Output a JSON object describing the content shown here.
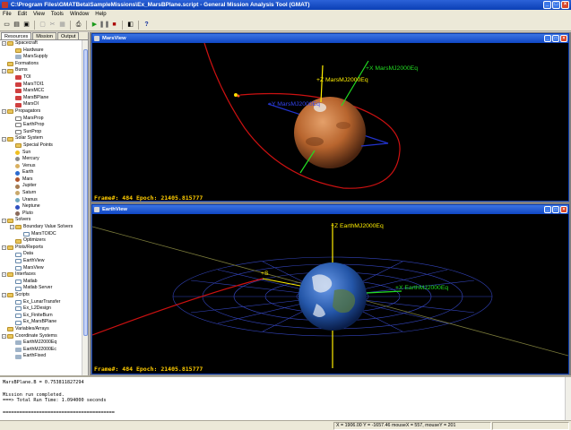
{
  "app": {
    "title": "C:\\Program Files\\GMATBeta\\SampleMissions\\Ex_MarsBPlane.script - General Mission Analysis Tool (GMAT)"
  },
  "menu": [
    "File",
    "Edit",
    "View",
    "Tools",
    "Window",
    "Help"
  ],
  "left_tabs": [
    "Resources",
    "Mission",
    "Output"
  ],
  "tree": [
    {
      "level": 0,
      "expander": "-",
      "icon": "folder",
      "label": "Spacecraft"
    },
    {
      "level": 1,
      "icon": "folder",
      "label": "Hardware"
    },
    {
      "level": 1,
      "icon": "item",
      "label": "MarsSupply"
    },
    {
      "level": 0,
      "icon": "folder",
      "label": "Formations"
    },
    {
      "level": 0,
      "expander": "-",
      "icon": "folder",
      "label": "Burns"
    },
    {
      "level": 1,
      "icon": "burn",
      "label": "TOI"
    },
    {
      "level": 1,
      "icon": "burn",
      "label": "MarsTOI1"
    },
    {
      "level": 1,
      "icon": "burn",
      "label": "MarsMCC"
    },
    {
      "level": 1,
      "icon": "burn",
      "label": "MarsBPlane"
    },
    {
      "level": 1,
      "icon": "burn",
      "label": "MarsOI"
    },
    {
      "level": 0,
      "expander": "-",
      "icon": "folder",
      "label": "Propagators"
    },
    {
      "level": 1,
      "icon": "prop",
      "label": "MarsProp"
    },
    {
      "level": 1,
      "icon": "prop",
      "label": "EarthProp"
    },
    {
      "level": 1,
      "icon": "prop",
      "label": "SunProp"
    },
    {
      "level": 0,
      "expander": "-",
      "icon": "folder",
      "label": "Solar System"
    },
    {
      "level": 1,
      "icon": "folder",
      "label": "Special Points"
    },
    {
      "level": 1,
      "icon": "planet",
      "color": "#f0c020",
      "label": "Sun"
    },
    {
      "level": 1,
      "icon": "planet",
      "color": "#8a8a8a",
      "label": "Mercury"
    },
    {
      "level": 1,
      "icon": "planet",
      "color": "#d9b060",
      "label": "Venus"
    },
    {
      "level": 1,
      "icon": "planet",
      "color": "#2c6bd0",
      "label": "Earth"
    },
    {
      "level": 1,
      "icon": "planet",
      "color": "#b2552a",
      "label": "Mars"
    },
    {
      "level": 1,
      "icon": "planet",
      "color": "#a67c52",
      "label": "Jupiter"
    },
    {
      "level": 1,
      "icon": "planet",
      "color": "#c9a86b",
      "label": "Saturn"
    },
    {
      "level": 1,
      "icon": "planet",
      "color": "#6fa8c0",
      "label": "Uranus"
    },
    {
      "level": 1,
      "icon": "planet",
      "color": "#3050c0",
      "label": "Neptune"
    },
    {
      "level": 1,
      "icon": "planet",
      "color": "#8a6a5a",
      "label": "Pluto"
    },
    {
      "level": 0,
      "expander": "-",
      "icon": "folder",
      "label": "Solvers"
    },
    {
      "level": 1,
      "expander": "-",
      "icon": "folder",
      "label": "Boundary Value Solvers"
    },
    {
      "level": 2,
      "icon": "doc",
      "label": "MarsTOIDC"
    },
    {
      "level": 1,
      "icon": "folder",
      "label": "Optimizers"
    },
    {
      "level": 0,
      "expander": "-",
      "icon": "folder",
      "label": "Plots/Reports"
    },
    {
      "level": 1,
      "icon": "doc",
      "label": "Data"
    },
    {
      "level": 1,
      "icon": "doc",
      "label": "EarthView"
    },
    {
      "level": 1,
      "icon": "doc",
      "label": "MarsView"
    },
    {
      "level": 0,
      "expander": "-",
      "icon": "folder",
      "label": "Interfaces"
    },
    {
      "level": 1,
      "icon": "doc",
      "label": "Matlab"
    },
    {
      "level": 1,
      "icon": "doc",
      "label": "Matlab Server"
    },
    {
      "level": 0,
      "expander": "-",
      "icon": "folder",
      "label": "Scripts"
    },
    {
      "level": 1,
      "icon": "doc",
      "label": "Ex_LunarTransfer"
    },
    {
      "level": 1,
      "icon": "doc",
      "label": "Ex_L2Design"
    },
    {
      "level": 1,
      "icon": "doc",
      "label": "Ex_FiniteBurn"
    },
    {
      "level": 1,
      "icon": "doc",
      "label": "Ex_MarsBPlane"
    },
    {
      "level": 0,
      "icon": "folder",
      "label": "Variables/Arrays"
    },
    {
      "level": 0,
      "expander": "-",
      "icon": "folder",
      "label": "Coordinate Systems"
    },
    {
      "level": 1,
      "icon": "item",
      "label": "EarthMJ2000Eq"
    },
    {
      "level": 1,
      "icon": "item",
      "label": "EarthMJ2000Ec"
    },
    {
      "level": 1,
      "icon": "item",
      "label": "EarthFixed"
    }
  ],
  "mars_view": {
    "title": "MarsView",
    "frame_text": "Frame#: 484  Epoch: 21405.815777",
    "axis_z": "+Z MarsMJ2000Eq",
    "axis_x": "+X MarsMJ2000Eq",
    "axis_y": "+Y MarsMJ2000Eq"
  },
  "earth_view": {
    "title": "EarthView",
    "frame_text": "Frame#: 484  Epoch: 21405.815777",
    "axis_z": "+Z EarthMJ2000Eq",
    "axis_x": "+X EarthMJ2000Eq",
    "axis_s": "+S"
  },
  "output": {
    "lines": [
      "MarsBPlane.B = 0.753811827294",
      "",
      "Mission run completed.",
      "===> Total Run Time: 1.094000 seconds",
      "",
      "========================================"
    ]
  },
  "status": {
    "coords": "X = 1906.00 Y = -1657.46 mouseX = 557, mouseY = 201"
  },
  "colors": {
    "title_blue": "#0a3fb5",
    "frame_text": "#ffcc00",
    "orbit_red": "#cc1111",
    "grid_blue": "#3344bb"
  }
}
